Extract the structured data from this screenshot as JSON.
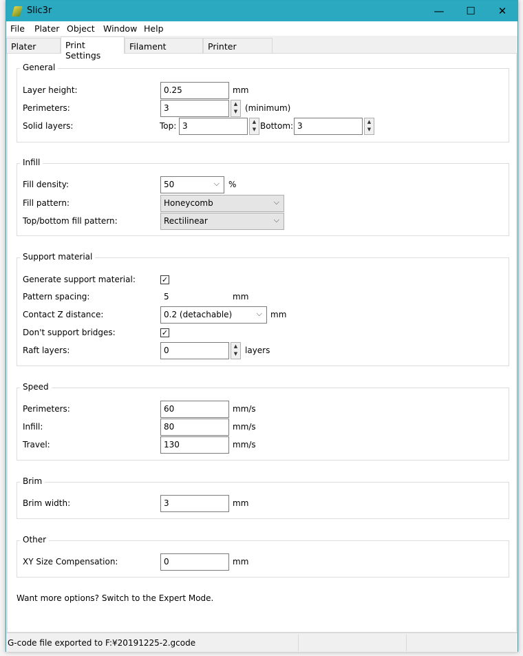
{
  "window": {
    "title": "Slic3r",
    "minimize": "—",
    "maximize": "☐",
    "close": "✕"
  },
  "menu": [
    "File",
    "Plater",
    "Object",
    "Window",
    "Help"
  ],
  "tabs": [
    "Plater",
    "Print Settings",
    "Filament Settings",
    "Printer Settings"
  ],
  "active_tab": "Print Settings",
  "general": {
    "title": "General",
    "layer_height_label": "Layer height:",
    "layer_height": "0.25",
    "layer_height_unit": "mm",
    "perimeters_label": "Perimeters:",
    "perimeters": "3",
    "perimeters_unit": "(minimum)",
    "solid_layers_label": "Solid layers:",
    "top_label": "Top:",
    "top": "3",
    "bottom_label": "Bottom:",
    "bottom": "3"
  },
  "infill": {
    "title": "Infill",
    "fill_density_label": "Fill density:",
    "fill_density": "50",
    "fill_density_unit": "%",
    "fill_pattern_label": "Fill pattern:",
    "fill_pattern": "Honeycomb",
    "tb_pattern_label": "Top/bottom fill pattern:",
    "tb_pattern": "Rectilinear"
  },
  "support": {
    "title": "Support material",
    "generate_label": "Generate support material:",
    "generate": true,
    "spacing_label": "Pattern spacing:",
    "spacing": "5",
    "spacing_unit": "mm",
    "contact_z_label": "Contact Z distance:",
    "contact_z": "0.2 (detachable)",
    "contact_z_unit": "mm",
    "no_bridges_label": "Don't support bridges:",
    "no_bridges": true,
    "raft_label": "Raft layers:",
    "raft": "0",
    "raft_unit": "layers"
  },
  "speed": {
    "title": "Speed",
    "perimeters_label": "Perimeters:",
    "perimeters": "60",
    "infill_label": "Infill:",
    "infill": "80",
    "travel_label": "Travel:",
    "travel": "130",
    "unit": "mm/s"
  },
  "brim": {
    "title": "Brim",
    "width_label": "Brim width:",
    "width": "3",
    "unit": "mm"
  },
  "other": {
    "title": "Other",
    "xy_label": "XY Size Compensation:",
    "xy": "0",
    "unit": "mm"
  },
  "footer": "Want more options? Switch to the Expert Mode.",
  "status": "G-code file exported to F:¥20191225-2.gcode",
  "icons": {
    "check": "✓",
    "chevron": "⌵",
    "up": "▲",
    "down": "▼"
  }
}
